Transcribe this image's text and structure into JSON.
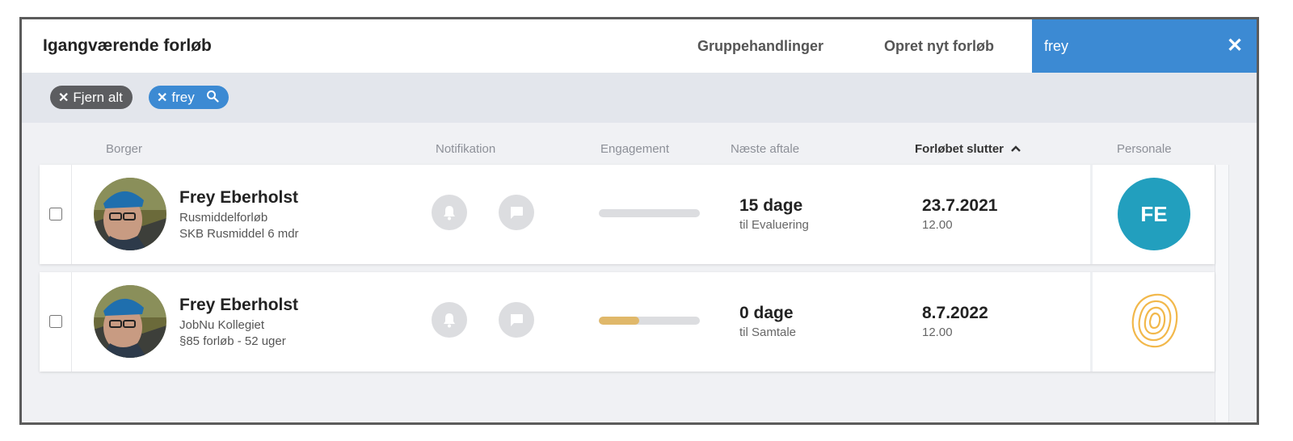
{
  "header": {
    "title": "Igangværende forløb",
    "group_actions": "Gruppehandlinger",
    "create_new": "Opret nyt forløb",
    "search_value": "frey",
    "close_icon": "close-icon"
  },
  "filters": {
    "clear_all": "Fjern alt",
    "term": "frey",
    "term_icon": "search-icon"
  },
  "columns": {
    "borger": "Borger",
    "notifikation": "Notifikation",
    "engagement": "Engagement",
    "naeste_aftale": "Næste aftale",
    "forloebet_slutter": "Forløbet slutter",
    "sort_icon": "chevron-up-icon",
    "personale": "Personale"
  },
  "rows": [
    {
      "name": "Frey Eberholst",
      "line1": "Rusmiddelforløb",
      "line2": "SKB Rusmiddel 6 mdr",
      "engagement": 0,
      "next_appt_days": "15 dage",
      "next_appt_type": "til Evaluering",
      "end_date": "23.7.2021",
      "end_time": "12.00",
      "staff_initials": "FE",
      "staff_color": "#229fbe"
    },
    {
      "name": "Frey Eberholst",
      "line1": "JobNu Kollegiet",
      "line2": "§85 forløb - 52 uger",
      "engagement": 0.4,
      "next_appt_days": "0 dage",
      "next_appt_type": "til Samtale",
      "end_date": "8.7.2022",
      "end_time": "12.00",
      "staff_logo": "contour-logo-icon",
      "staff_color": "#f2b84b"
    }
  ],
  "colors": {
    "accent": "#3c8ad3",
    "chip_clear": "#5c5d60",
    "engagement_fill": "#e0b86a",
    "filter_bg": "#e3e6ec"
  }
}
